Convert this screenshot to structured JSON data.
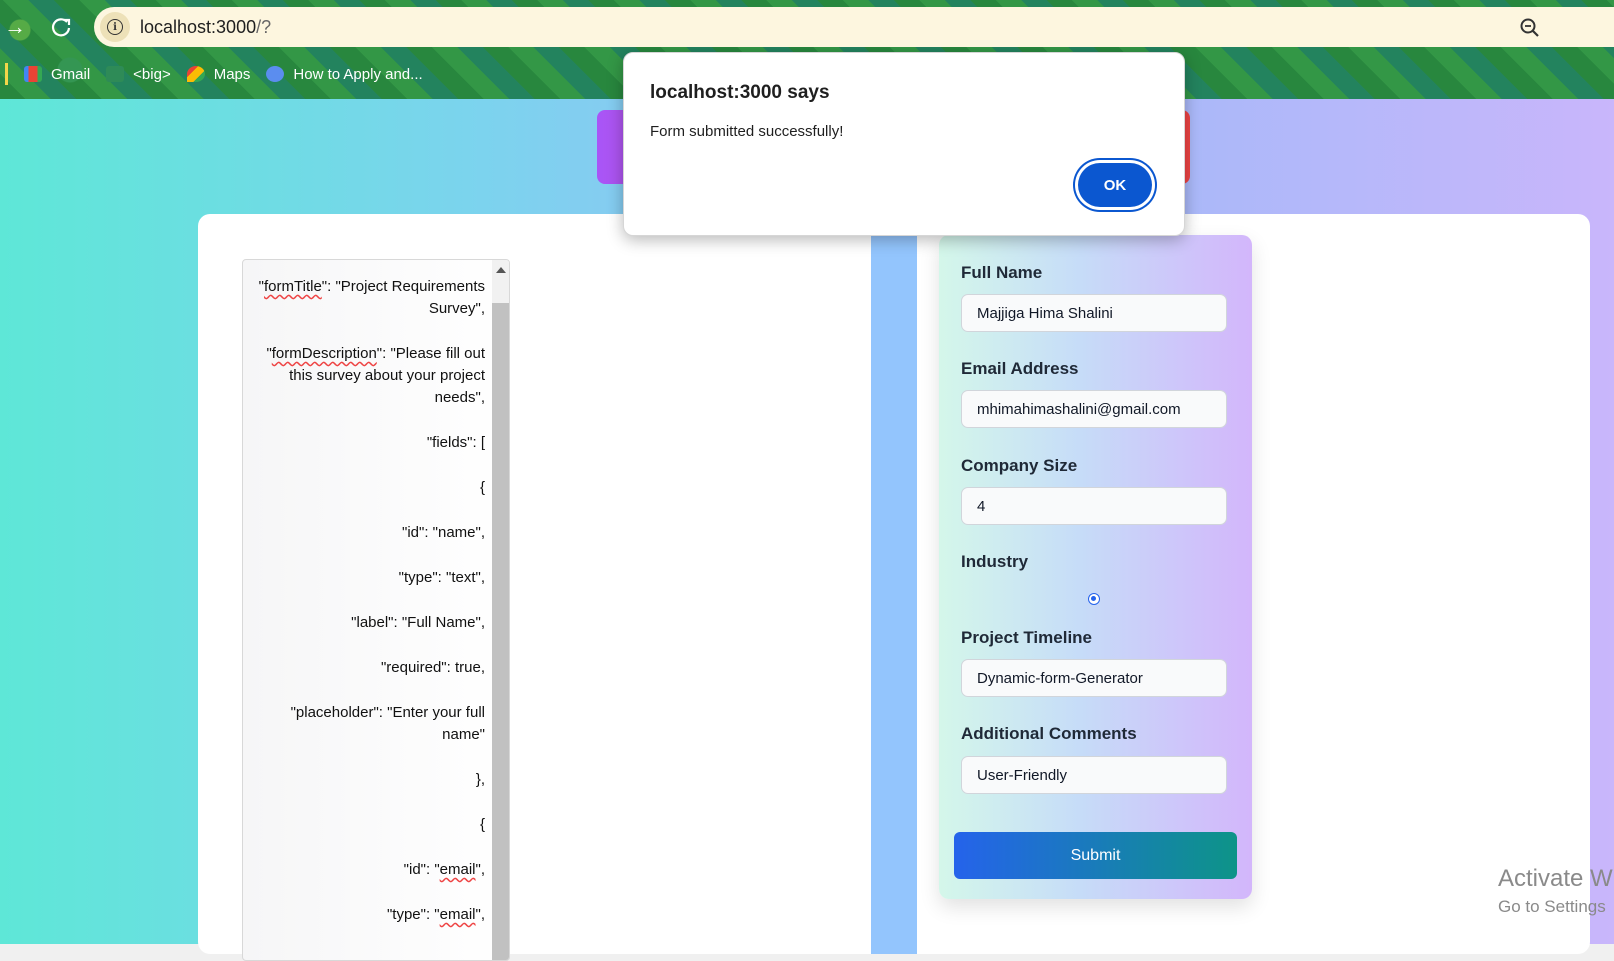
{
  "browser": {
    "url_host": "localhost:3000",
    "url_path": "/?",
    "bookmarks": [
      {
        "label": "Gmail",
        "icon": "gmail-icon"
      },
      {
        "label": "<big>",
        "icon": "site-icon"
      },
      {
        "label": "Maps",
        "icon": "maps-icon"
      },
      {
        "label": "How to Apply and...",
        "icon": "globe-icon"
      }
    ]
  },
  "json_editor": {
    "lines": [
      {
        "pre": "\"",
        "u": "formTitle",
        "post": "\": \"Project Requirements Survey\","
      },
      {
        "pre": "\"",
        "u": "formDescription",
        "post": "\": \"Please fill out this survey about your project needs\","
      },
      {
        "pre": "\"fields\": [",
        "u": "",
        "post": ""
      },
      {
        "pre": "{",
        "u": "",
        "post": ""
      },
      {
        "pre": "\"id\": \"name\",",
        "u": "",
        "post": ""
      },
      {
        "pre": "\"type\": \"text\",",
        "u": "",
        "post": ""
      },
      {
        "pre": "\"label\": \"Full Name\",",
        "u": "",
        "post": ""
      },
      {
        "pre": "\"required\": true,",
        "u": "",
        "post": ""
      },
      {
        "pre": "\"placeholder\": \"Enter your full name\"",
        "u": "",
        "post": ""
      },
      {
        "pre": "},",
        "u": "",
        "post": ""
      },
      {
        "pre": "{",
        "u": "",
        "post": ""
      },
      {
        "pre": "\"id\": \"",
        "u": "email",
        "post": "\","
      },
      {
        "pre": "\"type\": \"",
        "u": "email",
        "post": "\","
      }
    ]
  },
  "form": {
    "fields": [
      {
        "label": "Full Name",
        "value": "Majjiga Hima Shalini"
      },
      {
        "label": "Email Address",
        "value": "mhimahimashalini@gmail.com"
      },
      {
        "label": "Company Size",
        "value": "4"
      },
      {
        "label": "Industry",
        "value": ""
      },
      {
        "label": "Project Timeline",
        "value": "Dynamic-form-Generator"
      },
      {
        "label": "Additional Comments",
        "value": "User-Friendly"
      }
    ],
    "submit_label": "Submit"
  },
  "dialog": {
    "title": "localhost:3000 says",
    "message": "Form submitted successfully!",
    "ok_label": "OK"
  },
  "watermark": {
    "line1": "Activate W",
    "line2": "Go to Settings"
  },
  "colors": {
    "accent": "#0b57d0",
    "submit_start": "#2563eb",
    "submit_end": "#0d9488"
  }
}
